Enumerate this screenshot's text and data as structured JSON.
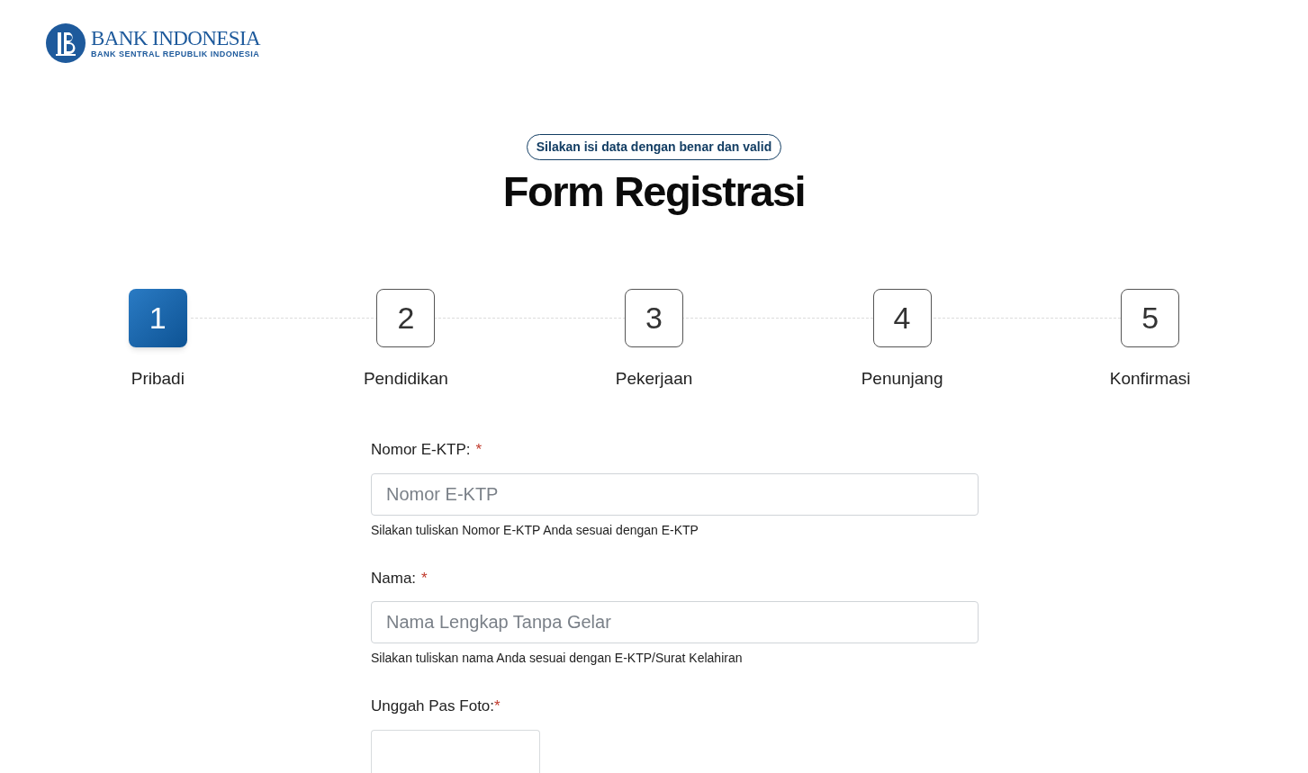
{
  "logo": {
    "name": "BANK INDONESIA",
    "tagline": "BANK SENTRAL REPUBLIK INDONESIA"
  },
  "badge": "Silakan isi data dengan benar dan valid",
  "title": "Form Registrasi",
  "steps": [
    {
      "number": "1",
      "label": "Pribadi",
      "selected": true
    },
    {
      "number": "2",
      "label": "Pendidikan",
      "selected": false
    },
    {
      "number": "3",
      "label": "Pekerjaan",
      "selected": false
    },
    {
      "number": "4",
      "label": "Penunjang",
      "selected": false
    },
    {
      "number": "5",
      "label": "Konfirmasi",
      "selected": false
    }
  ],
  "fields": [
    {
      "kind": "text",
      "label": "Nomor E-KTP:",
      "required_mark": "*",
      "placeholder": "Nomor E-KTP",
      "help": "Silakan tuliskan Nomor E-KTP Anda sesuai dengan E-KTP"
    },
    {
      "kind": "text",
      "label": "Nama:",
      "required_mark": "*",
      "placeholder": "Nama Lengkap Tanpa Gelar",
      "help": "Silakan tuliskan nama Anda sesuai dengan E-KTP/Surat Kelahiran"
    },
    {
      "kind": "photo",
      "label": "Unggah Pas Foto:",
      "required_mark": "*"
    }
  ]
}
